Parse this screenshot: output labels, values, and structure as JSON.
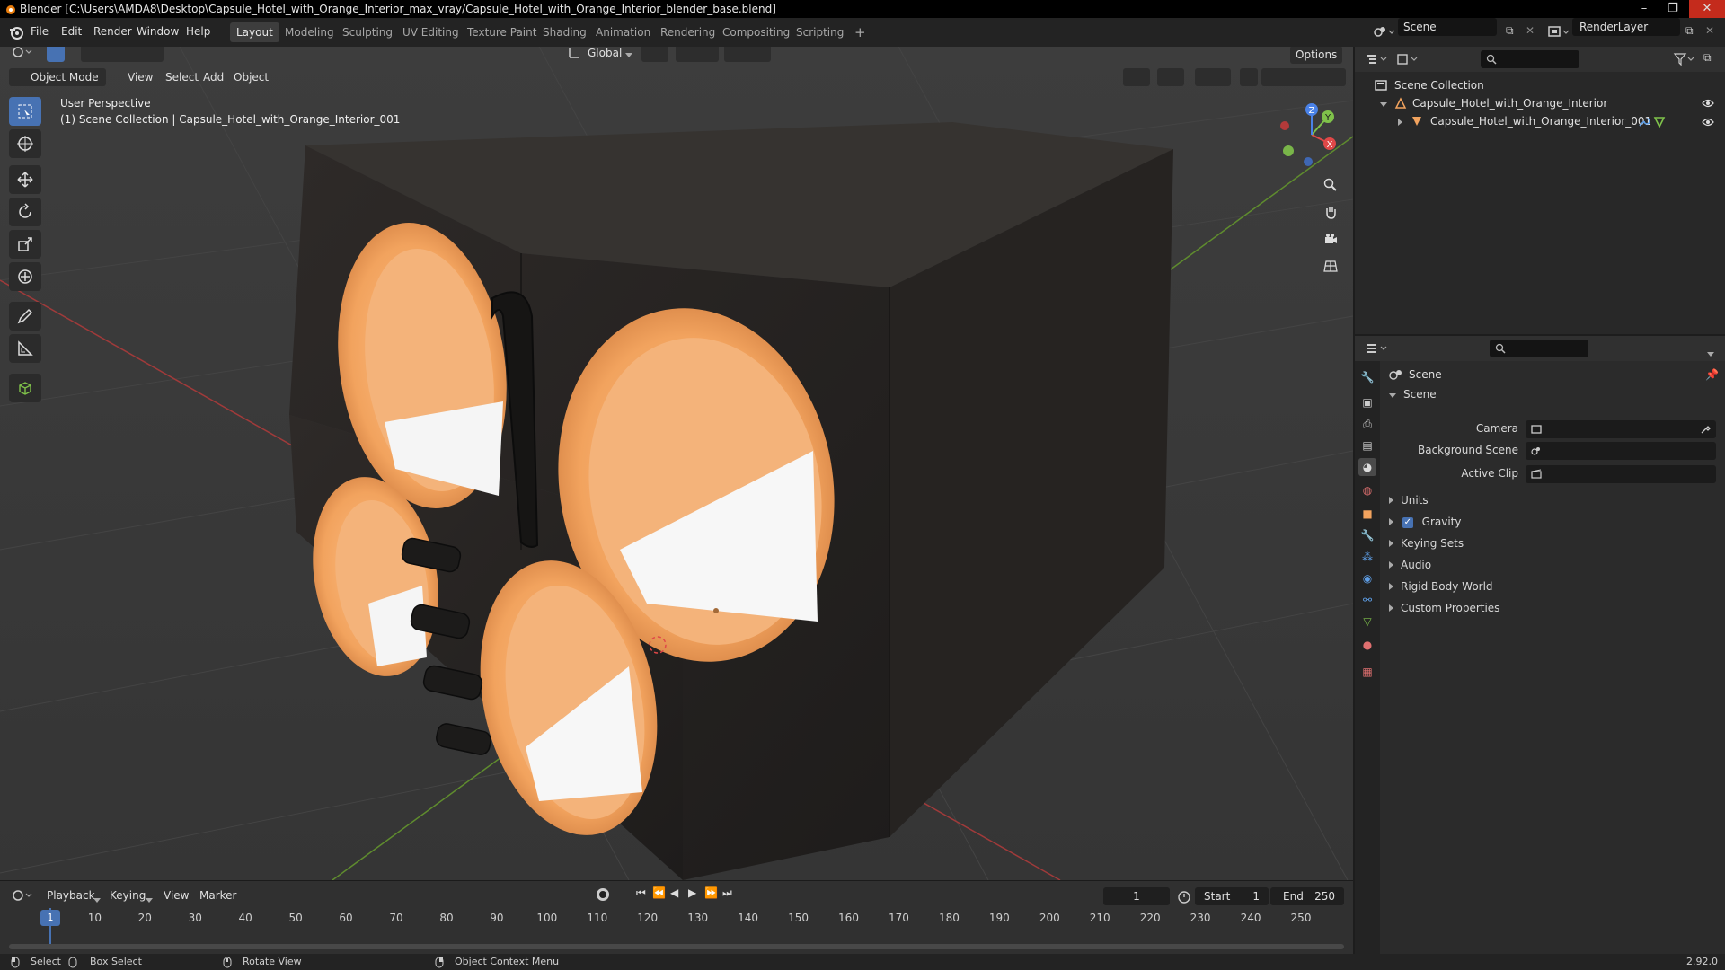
{
  "window": {
    "title": "Blender [C:\\Users\\AMDA8\\Desktop\\Capsule_Hotel_with_Orange_Interior_max_vray/Capsule_Hotel_with_Orange_Interior_blender_base.blend]"
  },
  "menu": [
    "File",
    "Edit",
    "Render",
    "Window",
    "Help"
  ],
  "workspaces": [
    "Layout",
    "Modeling",
    "Sculpting",
    "UV Editing",
    "Texture Paint",
    "Shading",
    "Animation",
    "Rendering",
    "Compositing",
    "Scripting"
  ],
  "active_workspace": "Layout",
  "scene_field": "Scene",
  "renderlayer_field": "RenderLayer",
  "viewport_header": {
    "transform_orientation": "Global",
    "options": "Options",
    "mode": "Object Mode",
    "menus": [
      "View",
      "Select",
      "Add",
      "Object"
    ]
  },
  "viewport": {
    "perspective": "User Perspective",
    "context": "(1) Scene Collection | Capsule_Hotel_with_Orange_Interior_001",
    "gizmo": {
      "x": "X",
      "y": "Y",
      "z": "Z"
    }
  },
  "timeline": {
    "menus": [
      "Playback",
      "Keying",
      "View",
      "Marker"
    ],
    "current_frame": "1",
    "start_label": "Start",
    "start": "1",
    "end_label": "End",
    "end": "250",
    "ticks": [
      "1",
      "10",
      "20",
      "30",
      "40",
      "50",
      "60",
      "70",
      "80",
      "90",
      "100",
      "110",
      "120",
      "130",
      "140",
      "150",
      "160",
      "170",
      "180",
      "190",
      "200",
      "210",
      "220",
      "230",
      "240",
      "250"
    ]
  },
  "outliner": {
    "root": "Scene Collection",
    "collection": "Capsule_Hotel_with_Orange_Interior",
    "object": "Capsule_Hotel_with_Orange_Interior_001"
  },
  "properties": {
    "context": "Scene",
    "panel": "Scene",
    "camera_label": "Camera",
    "background_label": "Background Scene",
    "clip_label": "Active Clip",
    "subpanels": [
      "Units",
      "Gravity",
      "Keying Sets",
      "Audio",
      "Rigid Body World",
      "Custom Properties"
    ],
    "gravity_checked": true
  },
  "status": {
    "select": "Select",
    "box_select": "Box Select",
    "rotate": "Rotate View",
    "context_menu": "Object Context Menu",
    "version": "2.92.0"
  },
  "colors": {
    "accent": "#4772b3",
    "orange": "#f2a35e",
    "capsule": "#2e2a28",
    "x_axis": "#e04848",
    "y_axis": "#7fc24a",
    "z_axis": "#4a82e8"
  }
}
